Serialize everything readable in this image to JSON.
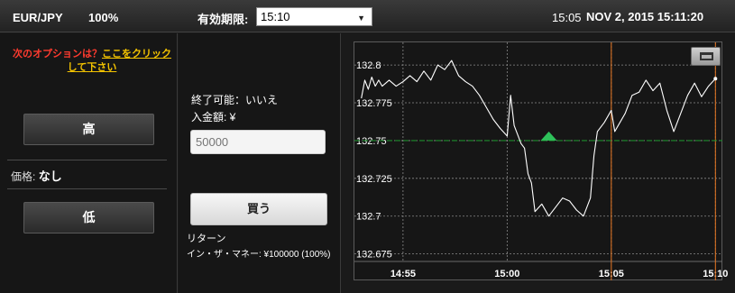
{
  "header": {
    "pair": "EUR/JPY",
    "payout": "100%",
    "expiry_label": "有効期限:",
    "expiry_value": "15:10",
    "clock_short": "15:05",
    "clock_full": "NOV 2, 2015 15:11:20"
  },
  "left": {
    "promo_question": "次のオプションは？",
    "promo_link": "ここをクリックして下さい",
    "high_label": "高",
    "low_label": "低",
    "price_label": "価格:",
    "price_value": "なし"
  },
  "middle": {
    "avail_label": "終了可能：",
    "avail_value": "いいえ",
    "deposit_label": "入金額: ¥",
    "amount_placeholder": "50000",
    "buy_label": "買う",
    "return_label": "リターン",
    "return_value": "イン・ザ・マネー: ¥100000 (100%)"
  },
  "colors": {
    "accent_orange": "#e87722",
    "entry_line_green": "#1c8c2c",
    "up_arrow": "#2ec15a",
    "promo_red": "#ff3b2f",
    "promo_link_yellow": "#f5c400"
  },
  "chart_data": {
    "type": "line",
    "x_ticks": [
      "14:55",
      "15:00",
      "15:05",
      "15:10"
    ],
    "y_ticks": [
      "132.8",
      "132.775",
      "132.75",
      "132.725",
      "132.7",
      "132.675"
    ],
    "ylim": [
      132.67,
      132.815
    ],
    "entry_price": 132.75,
    "entry_time": "15:02",
    "expiry_time": "15:10",
    "current_time": "15:05",
    "grid": true,
    "series": [
      {
        "values": [
          [
            "14:53:00",
            132.778
          ],
          [
            "14:53:10",
            132.79
          ],
          [
            "14:53:20",
            132.784
          ],
          [
            "14:53:30",
            132.792
          ],
          [
            "14:53:40",
            132.786
          ],
          [
            "14:53:50",
            132.79
          ],
          [
            "14:54:00",
            132.786
          ],
          [
            "14:54:20",
            132.79
          ],
          [
            "14:54:40",
            132.786
          ],
          [
            "14:55:00",
            132.789
          ],
          [
            "14:55:20",
            132.793
          ],
          [
            "14:55:40",
            132.789
          ],
          [
            "14:56:00",
            132.796
          ],
          [
            "14:56:20",
            132.79
          ],
          [
            "14:56:40",
            132.8
          ],
          [
            "14:57:00",
            132.797
          ],
          [
            "14:57:20",
            132.803
          ],
          [
            "14:57:40",
            132.793
          ],
          [
            "14:58:00",
            132.789
          ],
          [
            "14:58:20",
            132.786
          ],
          [
            "14:58:40",
            132.78
          ],
          [
            "14:59:00",
            132.772
          ],
          [
            "14:59:20",
            132.764
          ],
          [
            "14:59:40",
            132.758
          ],
          [
            "15:00:00",
            132.753
          ],
          [
            "15:00:10",
            132.78
          ],
          [
            "15:00:20",
            132.76
          ],
          [
            "15:00:40",
            132.748
          ],
          [
            "15:00:50",
            132.745
          ],
          [
            "15:01:00",
            132.728
          ],
          [
            "15:01:10",
            132.722
          ],
          [
            "15:01:20",
            132.703
          ],
          [
            "15:01:40",
            132.708
          ],
          [
            "15:02:00",
            132.7
          ],
          [
            "15:02:20",
            132.706
          ],
          [
            "15:02:40",
            132.712
          ],
          [
            "15:03:00",
            132.71
          ],
          [
            "15:03:20",
            132.704
          ],
          [
            "15:03:40",
            132.7
          ],
          [
            "15:04:00",
            132.712
          ],
          [
            "15:04:10",
            132.74
          ],
          [
            "15:04:20",
            132.756
          ],
          [
            "15:04:40",
            132.762
          ],
          [
            "15:05:00",
            132.77
          ],
          [
            "15:05:10",
            132.756
          ],
          [
            "15:05:20",
            132.76
          ],
          [
            "15:05:40",
            132.768
          ],
          [
            "15:06:00",
            132.78
          ],
          [
            "15:06:20",
            132.782
          ],
          [
            "15:06:40",
            132.79
          ],
          [
            "15:07:00",
            132.783
          ],
          [
            "15:07:20",
            132.788
          ],
          [
            "15:07:40",
            132.77
          ],
          [
            "15:08:00",
            132.756
          ],
          [
            "15:08:20",
            132.768
          ],
          [
            "15:08:40",
            132.78
          ],
          [
            "15:09:00",
            132.788
          ],
          [
            "15:09:20",
            132.779
          ],
          [
            "15:09:40",
            132.786
          ],
          [
            "15:10:00",
            132.791
          ]
        ]
      }
    ]
  }
}
